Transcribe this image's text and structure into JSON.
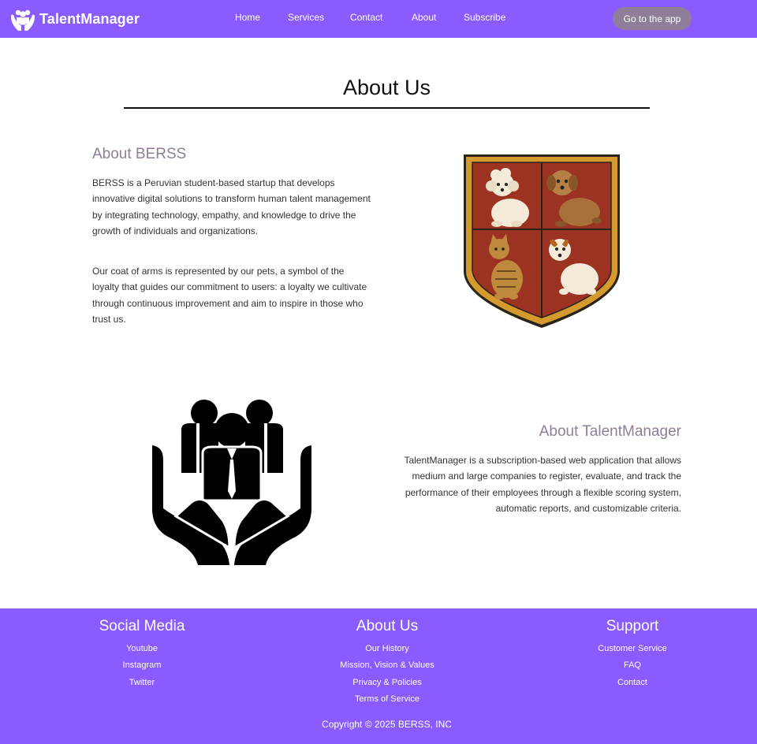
{
  "nav": {
    "brand": "TalentManager",
    "links": [
      "Home",
      "Services",
      "Contact",
      "About",
      "Subscribe"
    ],
    "cta": "Go to the app"
  },
  "page": {
    "title": "About Us"
  },
  "berss": {
    "heading": "About BERSS",
    "p1": "BERSS is a Peruvian student-based startup that develops innovative digital solutions to transform human talent management by integrating technology, empathy, and knowledge to drive the growth of individuals and organizations.",
    "p2": "Our coat of arms is represented by our pets, a symbol of the loyalty that guides our commitment to users: a loyalty we cultivate through continuous improvement and aim to inspire in those who trust us.",
    "image_icon": "coat-of-arms-pets"
  },
  "talentmanager": {
    "heading": "About TalentManager",
    "p": "TalentManager is a subscription-based web application that allows medium and large companies to register, evaluate, and track the performance of their employees through a flexible scoring system, automatic reports, and customizable criteria.",
    "image_icon": "hands-holding-people"
  },
  "footer": {
    "social": {
      "title": "Social Media",
      "links": [
        "Youtube",
        "Instagram",
        "Twitter"
      ]
    },
    "about": {
      "title": "About Us",
      "links": [
        "Our History",
        "Mission, Vision & Values",
        "Privacy & Policies",
        "Terms of Service"
      ]
    },
    "support": {
      "title": "Support",
      "links": [
        "Customer Service",
        "FAQ",
        "Contact"
      ]
    },
    "copyright": "Copyright © 2025 BERSS, INC"
  },
  "colors": {
    "primary": "#8a5cff",
    "accent_text": "#8f7d99",
    "button": "#8f7d99",
    "crest_red": "#9b3222",
    "crest_gold": "#d49a2e"
  }
}
